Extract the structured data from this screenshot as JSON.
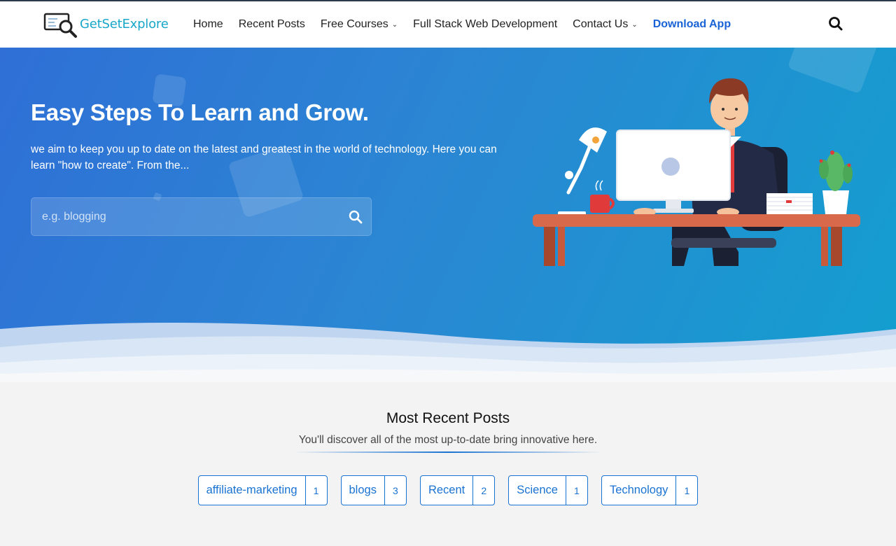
{
  "header": {
    "brand": "GetSetExplore",
    "nav": [
      {
        "label": "Home",
        "dropdown": false
      },
      {
        "label": "Recent Posts",
        "dropdown": false
      },
      {
        "label": "Free Courses",
        "dropdown": true
      },
      {
        "label": "Full Stack Web Development",
        "dropdown": false
      },
      {
        "label": "Contact Us",
        "dropdown": true
      },
      {
        "label": "Download App",
        "dropdown": false,
        "accent": true
      }
    ],
    "search_icon": "search-icon"
  },
  "hero": {
    "title": "Easy Steps To Learn and Grow.",
    "description": "we aim to keep you up to date on the latest and greatest in the world of technology. Here you can learn \"how to create\". From the...",
    "search_placeholder": "e.g. blogging"
  },
  "recent": {
    "title": "Most Recent Posts",
    "subtitle": "You'll discover all of the most up-to-date bring innovative here.",
    "tags": [
      {
        "name": "affiliate-marketing",
        "count": "1"
      },
      {
        "name": "blogs",
        "count": "3"
      },
      {
        "name": "Recent",
        "count": "2"
      },
      {
        "name": "Science",
        "count": "1"
      },
      {
        "name": "Technology",
        "count": "1"
      }
    ]
  },
  "colors": {
    "accent": "#1a73d2",
    "brand": "#18a7c9",
    "hero_start": "#2f6fd6",
    "hero_end": "#139fcf",
    "nav_accent": "#1a63d6"
  }
}
